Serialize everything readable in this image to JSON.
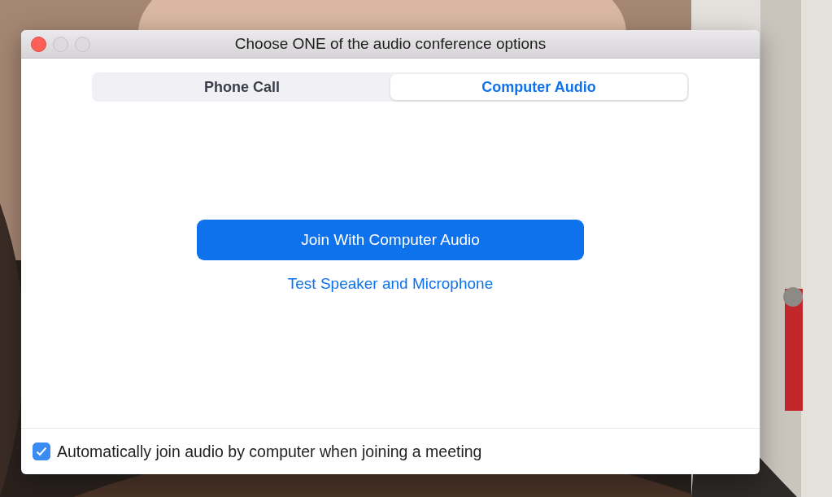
{
  "window": {
    "title": "Choose ONE of the audio conference options"
  },
  "tabs": [
    {
      "label": "Phone Call",
      "selected": false
    },
    {
      "label": "Computer Audio",
      "selected": true
    }
  ],
  "join_button": {
    "label": "Join With Computer Audio"
  },
  "test_link": {
    "label": "Test Speaker and Microphone"
  },
  "auto_join": {
    "label": "Automatically join audio by computer when joining a meeting",
    "checked": true
  }
}
